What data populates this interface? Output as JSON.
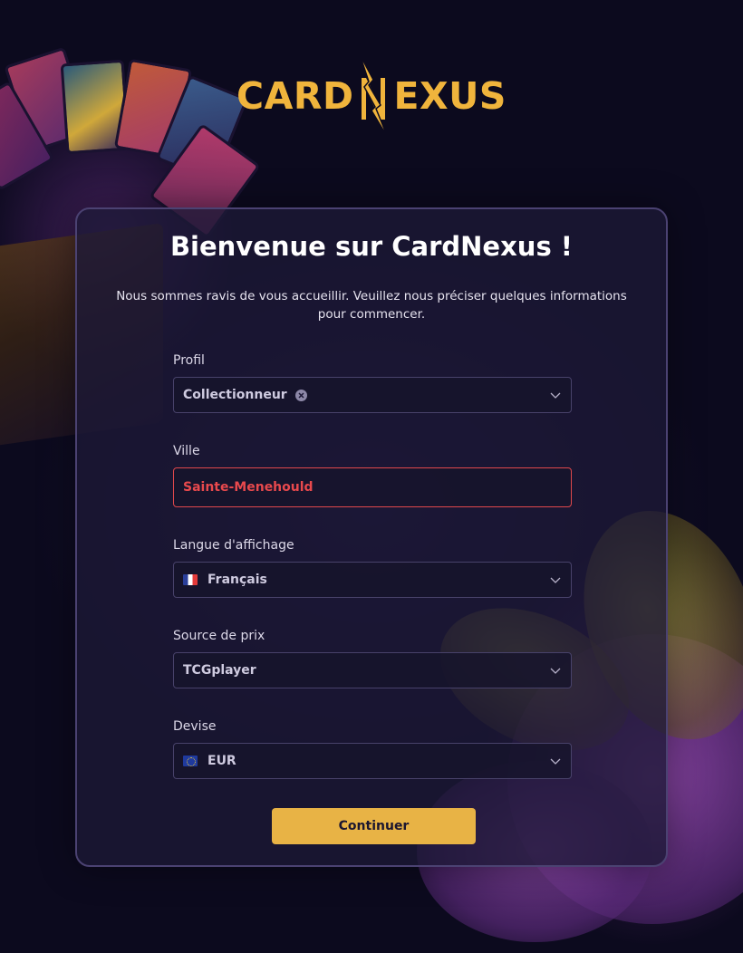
{
  "brand": {
    "logo_left": "CARD",
    "logo_right": "EXUS",
    "accent_color": "#f0b43c"
  },
  "form": {
    "title": "Bienvenue sur CardNexus !",
    "subtitle": "Nous sommes ravis de vous accueillir. Veuillez nous préciser quelques informations pour commencer.",
    "profil": {
      "label": "Profil",
      "value": "Collectionneur",
      "clear_icon": "clear-icon",
      "chevron_icon": "chevron-down-icon"
    },
    "ville": {
      "label": "Ville",
      "value": "Sainte-Menehould",
      "state": "error",
      "error_color": "#e0484c"
    },
    "langue": {
      "label": "Langue d'affichage",
      "value": "Français",
      "flag_icon": "flag-fr-icon",
      "chevron_icon": "chevron-down-icon"
    },
    "source": {
      "label": "Source de prix",
      "value": "TCGplayer",
      "chevron_icon": "chevron-down-icon"
    },
    "devise": {
      "label": "Devise",
      "value": "EUR",
      "flag_icon": "flag-eu-icon",
      "chevron_icon": "chevron-down-icon"
    },
    "submit_label": "Continuer",
    "submit_color": "#e8b345"
  }
}
